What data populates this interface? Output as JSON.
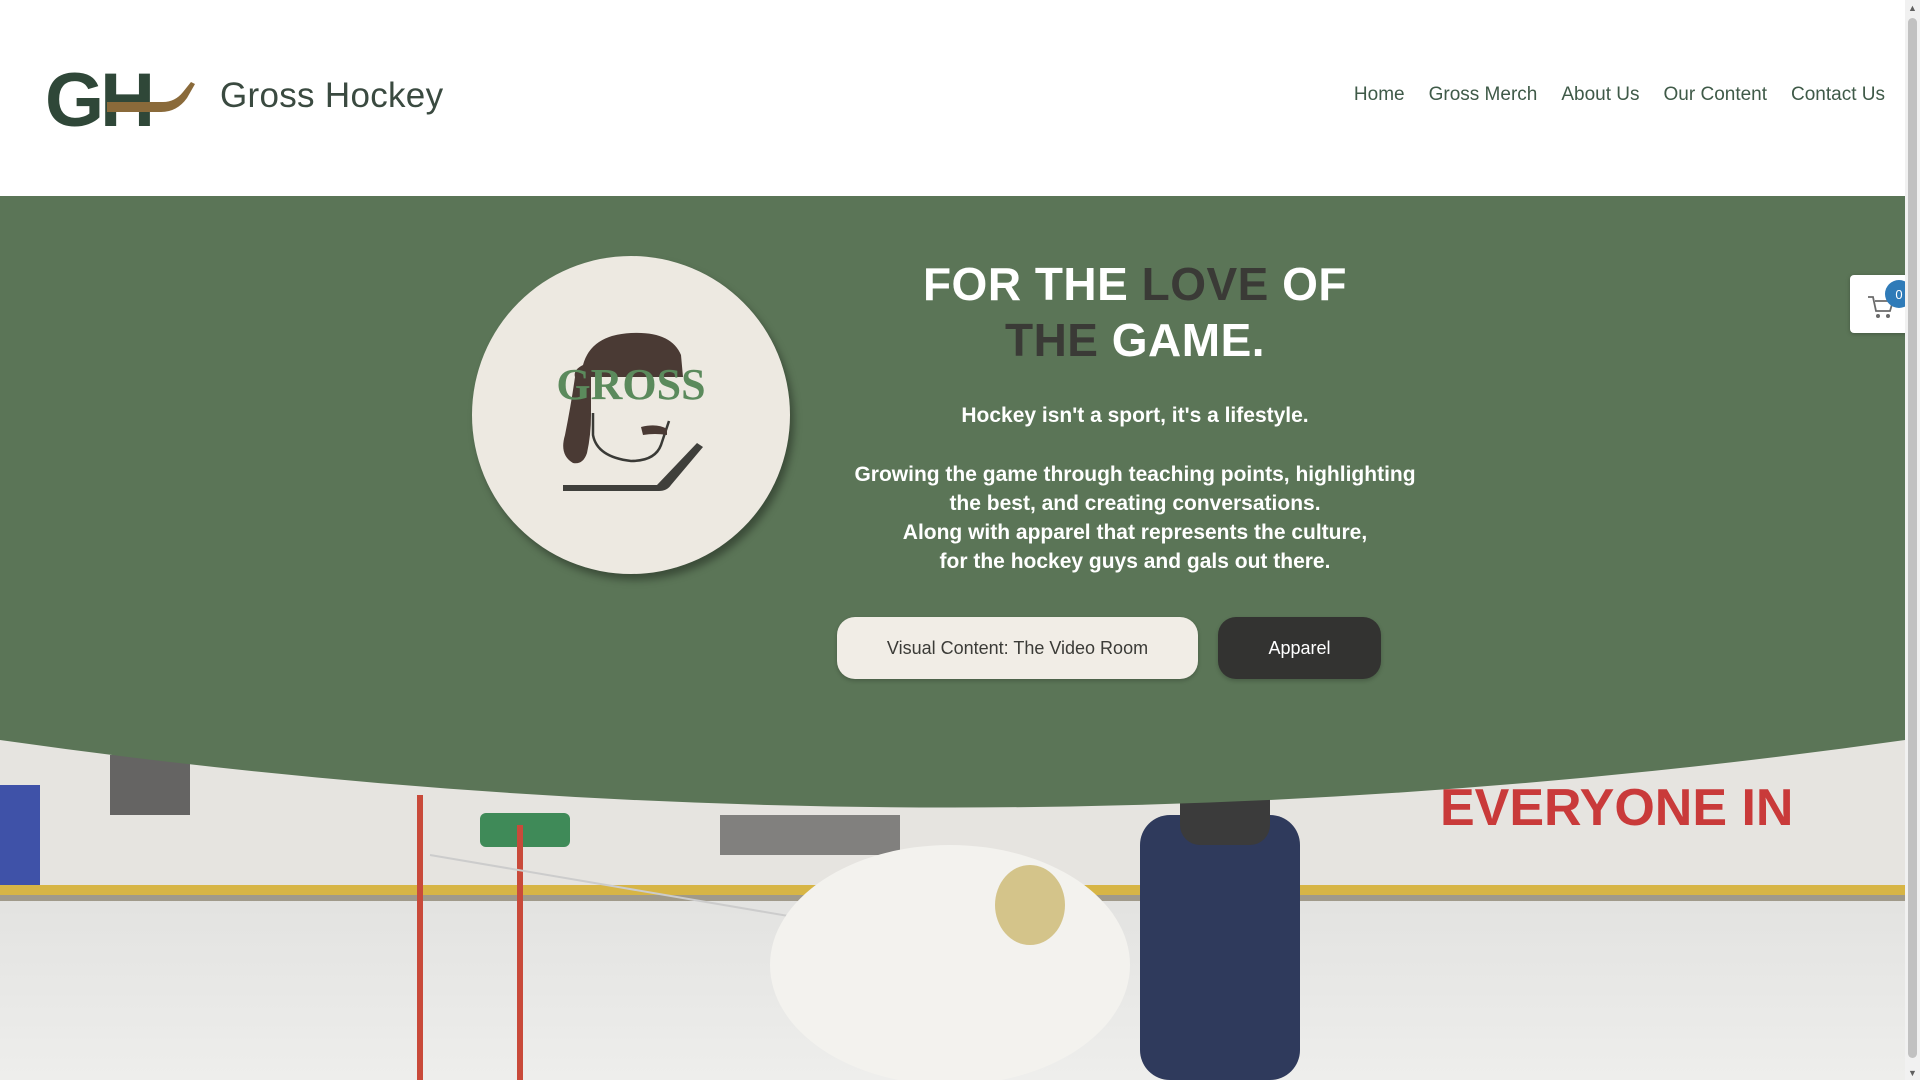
{
  "header": {
    "logo_text": "GH",
    "site_title": "Gross Hockey",
    "nav": [
      "Home",
      "Gross Merch",
      "About Us",
      "Our Content",
      "Contact Us"
    ]
  },
  "hero": {
    "headline_parts": [
      "FOR THE ",
      "LOVE",
      " OF ",
      "THE",
      " GAME."
    ],
    "tagline": "Hockey isn't a sport, it's a lifestyle.",
    "body_lines": [
      "Growing the game through teaching points, highlighting",
      "the best, and creating conversations.",
      "Along with apparel that represents the culture,",
      "for the hockey guys and gals out there."
    ],
    "badge_text": "GROSS",
    "buttons": {
      "video_room": "Visual Content: The Video Room",
      "apparel": "Apparel"
    }
  },
  "video": {
    "banner_text": "EVERYONE IN"
  },
  "cart": {
    "count": "0"
  },
  "colors": {
    "green": "#5b7557",
    "dark_green": "#2f4738",
    "cream": "#ede9e1",
    "dark": "#333331",
    "badge_blue": "#2f7bb8",
    "stick_brown": "#8a6a3a"
  }
}
